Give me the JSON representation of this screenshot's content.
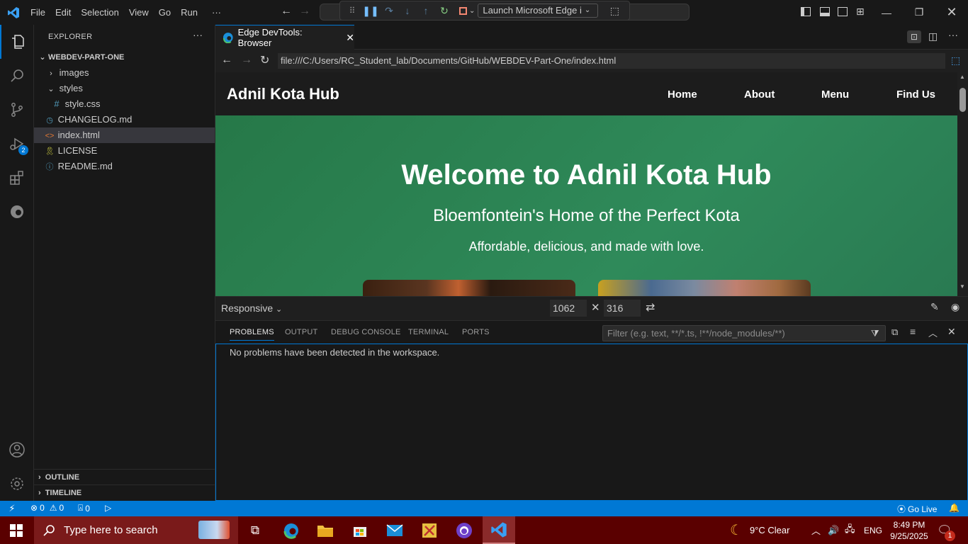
{
  "titlebar": {
    "menus": [
      "File",
      "Edit",
      "Selection",
      "View",
      "Go",
      "Run",
      "···"
    ],
    "debug_target": "Launch Microsoft Edge i"
  },
  "activity": {
    "run_badge": "2"
  },
  "explorer": {
    "title": "EXPLORER",
    "root": "WEBDEV-PART-ONE",
    "items": [
      {
        "label": "images",
        "kind": "folder-collapsed"
      },
      {
        "label": "styles",
        "kind": "folder-open"
      },
      {
        "label": "style.css",
        "kind": "css"
      },
      {
        "label": "CHANGELOG.md",
        "kind": "md"
      },
      {
        "label": "index.html",
        "kind": "html"
      },
      {
        "label": "LICENSE",
        "kind": "license"
      },
      {
        "label": "README.md",
        "kind": "info"
      }
    ],
    "outline": "OUTLINE",
    "timeline": "TIMELINE"
  },
  "editor": {
    "tab_label": "Edge DevTools: Browser",
    "url": "file:///C:/Users/RC_Student_lab/Documents/GitHub/WEBDEV-Part-One/index.html"
  },
  "site": {
    "logo": "Adnil Kota Hub",
    "nav": [
      "Home",
      "About",
      "Menu",
      "Find Us"
    ],
    "hero_title": "Welcome to Adnil Kota Hub",
    "hero_subtitle": "Bloemfontein's Home of the Perfect Kota",
    "hero_tagline": "Affordable, delicious, and made with love."
  },
  "responsive": {
    "mode": "Responsive",
    "width": "1062",
    "height": "316"
  },
  "panel": {
    "tabs": [
      "PROBLEMS",
      "OUTPUT",
      "DEBUG CONSOLE",
      "TERMINAL",
      "PORTS"
    ],
    "filter_placeholder": "Filter (e.g. text, **/*.ts, !**/node_modules/**)",
    "message": "No problems have been detected in the workspace."
  },
  "status": {
    "errors": "0",
    "warnings": "0",
    "ports": "0",
    "go_live": "Go Live"
  },
  "taskbar": {
    "search_placeholder": "Type here to search",
    "weather": "9°C  Clear",
    "language": "ENG",
    "time": "8:49 PM",
    "date": "9/25/2025",
    "notifications": "1"
  },
  "colors": {
    "accent": "#0078d4",
    "hero_green": "#2e7d54",
    "taskbar": "#5a0000"
  }
}
